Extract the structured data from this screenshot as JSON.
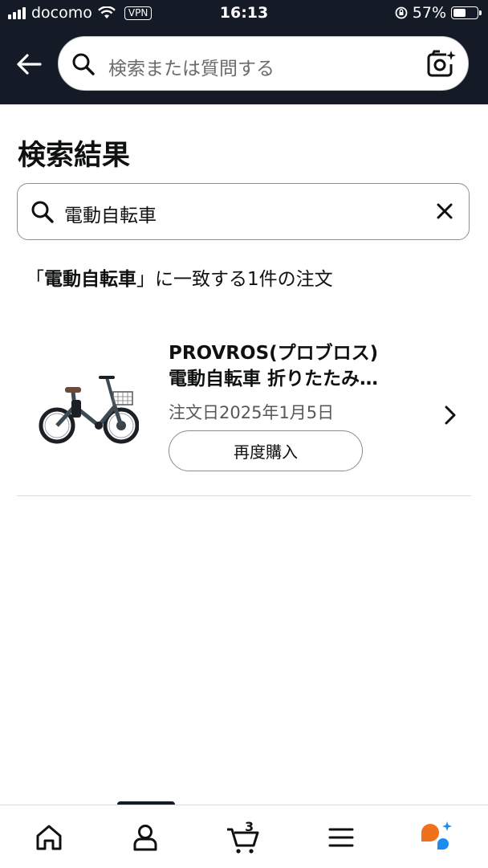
{
  "status_bar": {
    "carrier": "docomo",
    "vpn": "VPN",
    "time": "16:13",
    "battery_percent": "57%",
    "battery_level": 0.57
  },
  "header": {
    "search_placeholder": "検索または質問する",
    "icons": [
      "back-arrow-icon",
      "search-icon",
      "camera-lens-icon"
    ]
  },
  "page": {
    "title": "検索結果",
    "search_value": "電動自転車",
    "summary_open": "「",
    "summary_term": "電動自転車",
    "summary_rest": "」に一致する1件の注文"
  },
  "orders": [
    {
      "title_line1": "PROVROS(プロブロス)",
      "title_line2": "電動自転車 折りたたみ…",
      "date": "注文日2025年1月5日",
      "rebuy_label": "再度購入"
    }
  ],
  "tabbar": {
    "items": [
      "home-icon",
      "account-icon",
      "cart-icon",
      "menu-icon",
      "rufus-icon"
    ],
    "cart_count": "3"
  },
  "colors": {
    "header_bg": "#141b26",
    "text": "#0f1111",
    "secondary_text": "#565959",
    "rufus_orange": "#f0711b",
    "rufus_blue": "#1a8cf0"
  }
}
